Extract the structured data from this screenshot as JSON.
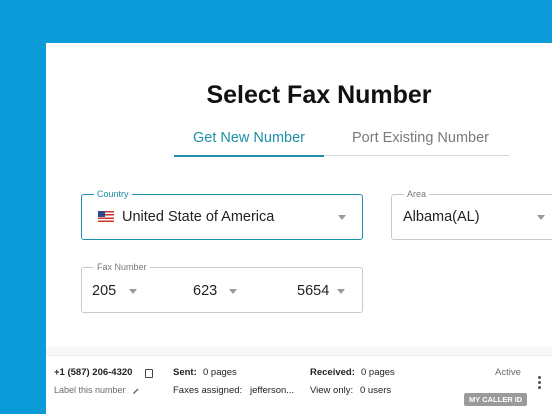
{
  "page": {
    "title": "Select Fax Number"
  },
  "tabs": [
    {
      "label": "Get New Number",
      "active": true
    },
    {
      "label": "Port Existing Number",
      "active": false
    }
  ],
  "country": {
    "legend": "Country",
    "value": "United State of America",
    "flag": "us-flag-icon"
  },
  "area": {
    "legend": "Area",
    "value": "Albama(AL)"
  },
  "fax_number": {
    "legend": "Fax Number",
    "part1": "205",
    "part2": "623",
    "part3": "5654"
  },
  "number_row": {
    "phone": "+1 (587) 206-4320",
    "label_link": "Label this number",
    "sent_label": "Sent:",
    "sent_value": "0 pages",
    "assigned_label": "Faxes assigned:",
    "assigned_value": "jefferson...",
    "received_label": "Received:",
    "received_value": "0 pages",
    "view_only_label": "View only:",
    "view_only_value": "0 users",
    "status": "Active",
    "badge": "MY CALLER ID"
  },
  "colors": {
    "background": "#0b9bd8",
    "accent": "#1e8fa8"
  }
}
